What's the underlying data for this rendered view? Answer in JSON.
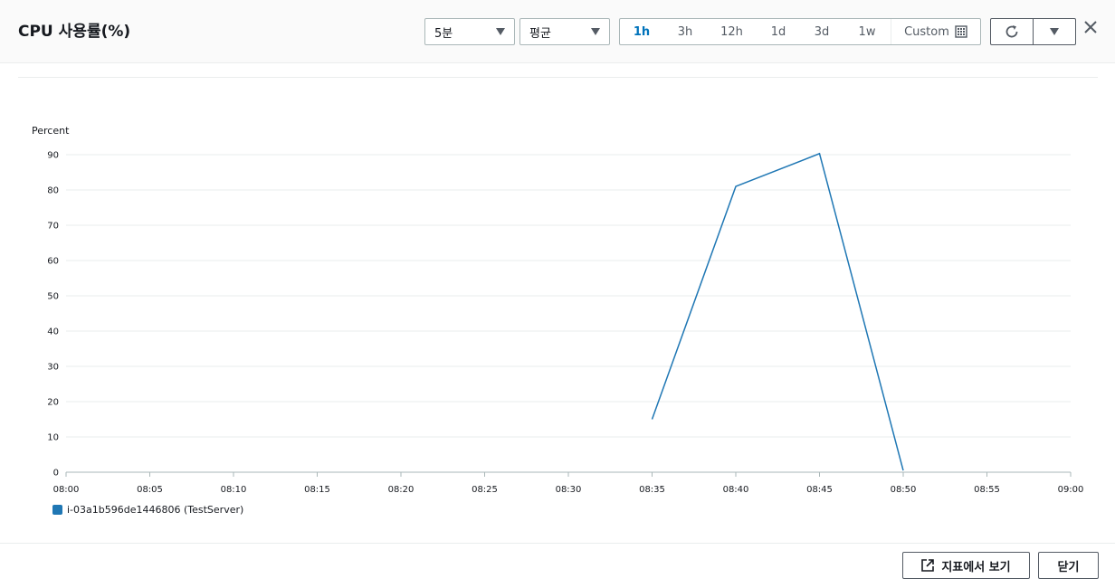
{
  "header": {
    "title": "CPU 사용률(%)",
    "period": "5분",
    "statistic": "평균",
    "ranges": [
      "1h",
      "3h",
      "12h",
      "1d",
      "3d",
      "1w"
    ],
    "active_range": "1h",
    "custom_label": "Custom"
  },
  "footer": {
    "view_metrics_label": "지표에서 보기",
    "close_label": "닫기"
  },
  "colors": {
    "series": "#1f77b4",
    "accent": "#0073bb"
  },
  "chart_data": {
    "type": "line",
    "ylabel": "Percent",
    "ylim": [
      0,
      90
    ],
    "yticks": [
      0,
      10,
      20,
      30,
      40,
      50,
      60,
      70,
      80,
      90
    ],
    "x_ticks": [
      "08:00",
      "08:05",
      "08:10",
      "08:15",
      "08:20",
      "08:25",
      "08:30",
      "08:35",
      "08:40",
      "08:45",
      "08:50",
      "08:55",
      "09:00"
    ],
    "grid": true,
    "legend_position": "bottom-left",
    "series": [
      {
        "name": "i-03a1b596de1446806 (TestServer)",
        "x": [
          "08:35",
          "08:40",
          "08:45",
          "08:50"
        ],
        "y": [
          15,
          81,
          90.3,
          0.5
        ]
      }
    ]
  }
}
